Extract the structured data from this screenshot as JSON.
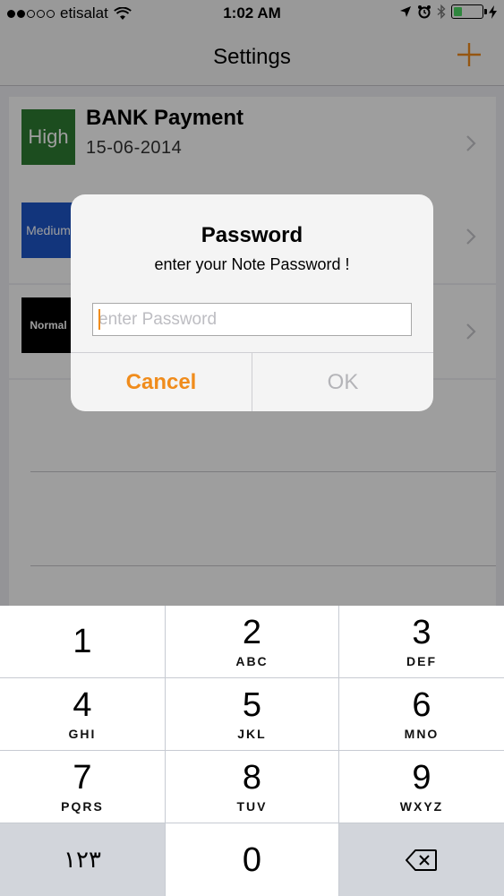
{
  "status_bar": {
    "carrier": "etisalat",
    "time": "1:02 AM"
  },
  "nav": {
    "title": "Settings",
    "accent_color": "#f08c1c"
  },
  "notes": [
    {
      "priority": "High",
      "priority_color": "#2e7d32",
      "title": "BANK Payment",
      "date": "15-06-2014"
    },
    {
      "priority": "Medium",
      "priority_color": "#1e56c8",
      "title": "",
      "date": ""
    },
    {
      "priority": "Normal",
      "priority_color": "#000000",
      "title": "",
      "date": ""
    }
  ],
  "alert": {
    "title": "Password",
    "message": "enter your Note Password !",
    "input_placeholder": "enter Password",
    "input_value": "",
    "cancel_label": "Cancel",
    "ok_label": "OK"
  },
  "keypad": {
    "keys": [
      {
        "digit": "1",
        "letters": ""
      },
      {
        "digit": "2",
        "letters": "ABC"
      },
      {
        "digit": "3",
        "letters": "DEF"
      },
      {
        "digit": "4",
        "letters": "GHI"
      },
      {
        "digit": "5",
        "letters": "JKL"
      },
      {
        "digit": "6",
        "letters": "MNO"
      },
      {
        "digit": "7",
        "letters": "PQRS"
      },
      {
        "digit": "8",
        "letters": "TUV"
      },
      {
        "digit": "9",
        "letters": "WXYZ"
      }
    ],
    "switch_label": "١٢٣",
    "zero": "0",
    "delete_icon": "backspace-icon"
  }
}
